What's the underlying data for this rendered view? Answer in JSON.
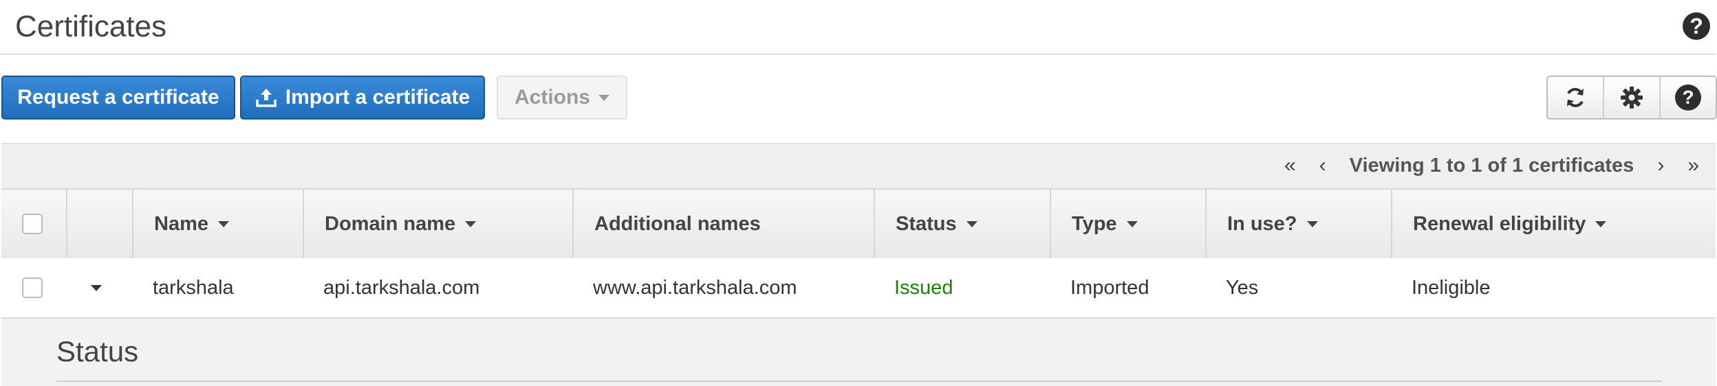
{
  "header": {
    "title": "Certificates",
    "help": "?"
  },
  "toolbar": {
    "request_label": "Request a certificate",
    "import_label": "Import a certificate",
    "actions_label": "Actions",
    "help": "?"
  },
  "pagination": {
    "text": "Viewing 1 to 1 of 1 certificates"
  },
  "table": {
    "columns": [
      "Name",
      "Domain name",
      "Additional names",
      "Status",
      "Type",
      "In use?",
      "Renewal eligibility"
    ],
    "rows": [
      {
        "name": "tarkshala",
        "domain": "api.tarkshala.com",
        "additional": "www.api.tarkshala.com",
        "status": "Issued",
        "type": "Imported",
        "in_use": "Yes",
        "renewal": "Ineligible"
      }
    ]
  },
  "detail": {
    "title": "Status"
  },
  "colors": {
    "primary": "#1f6fbf",
    "issued": "#1d8102"
  },
  "icons": [
    "help-icon",
    "upload-icon",
    "refresh-icon",
    "gear-icon",
    "first-page-icon",
    "prev-page-icon",
    "next-page-icon",
    "last-page-icon",
    "expand-icon"
  ]
}
